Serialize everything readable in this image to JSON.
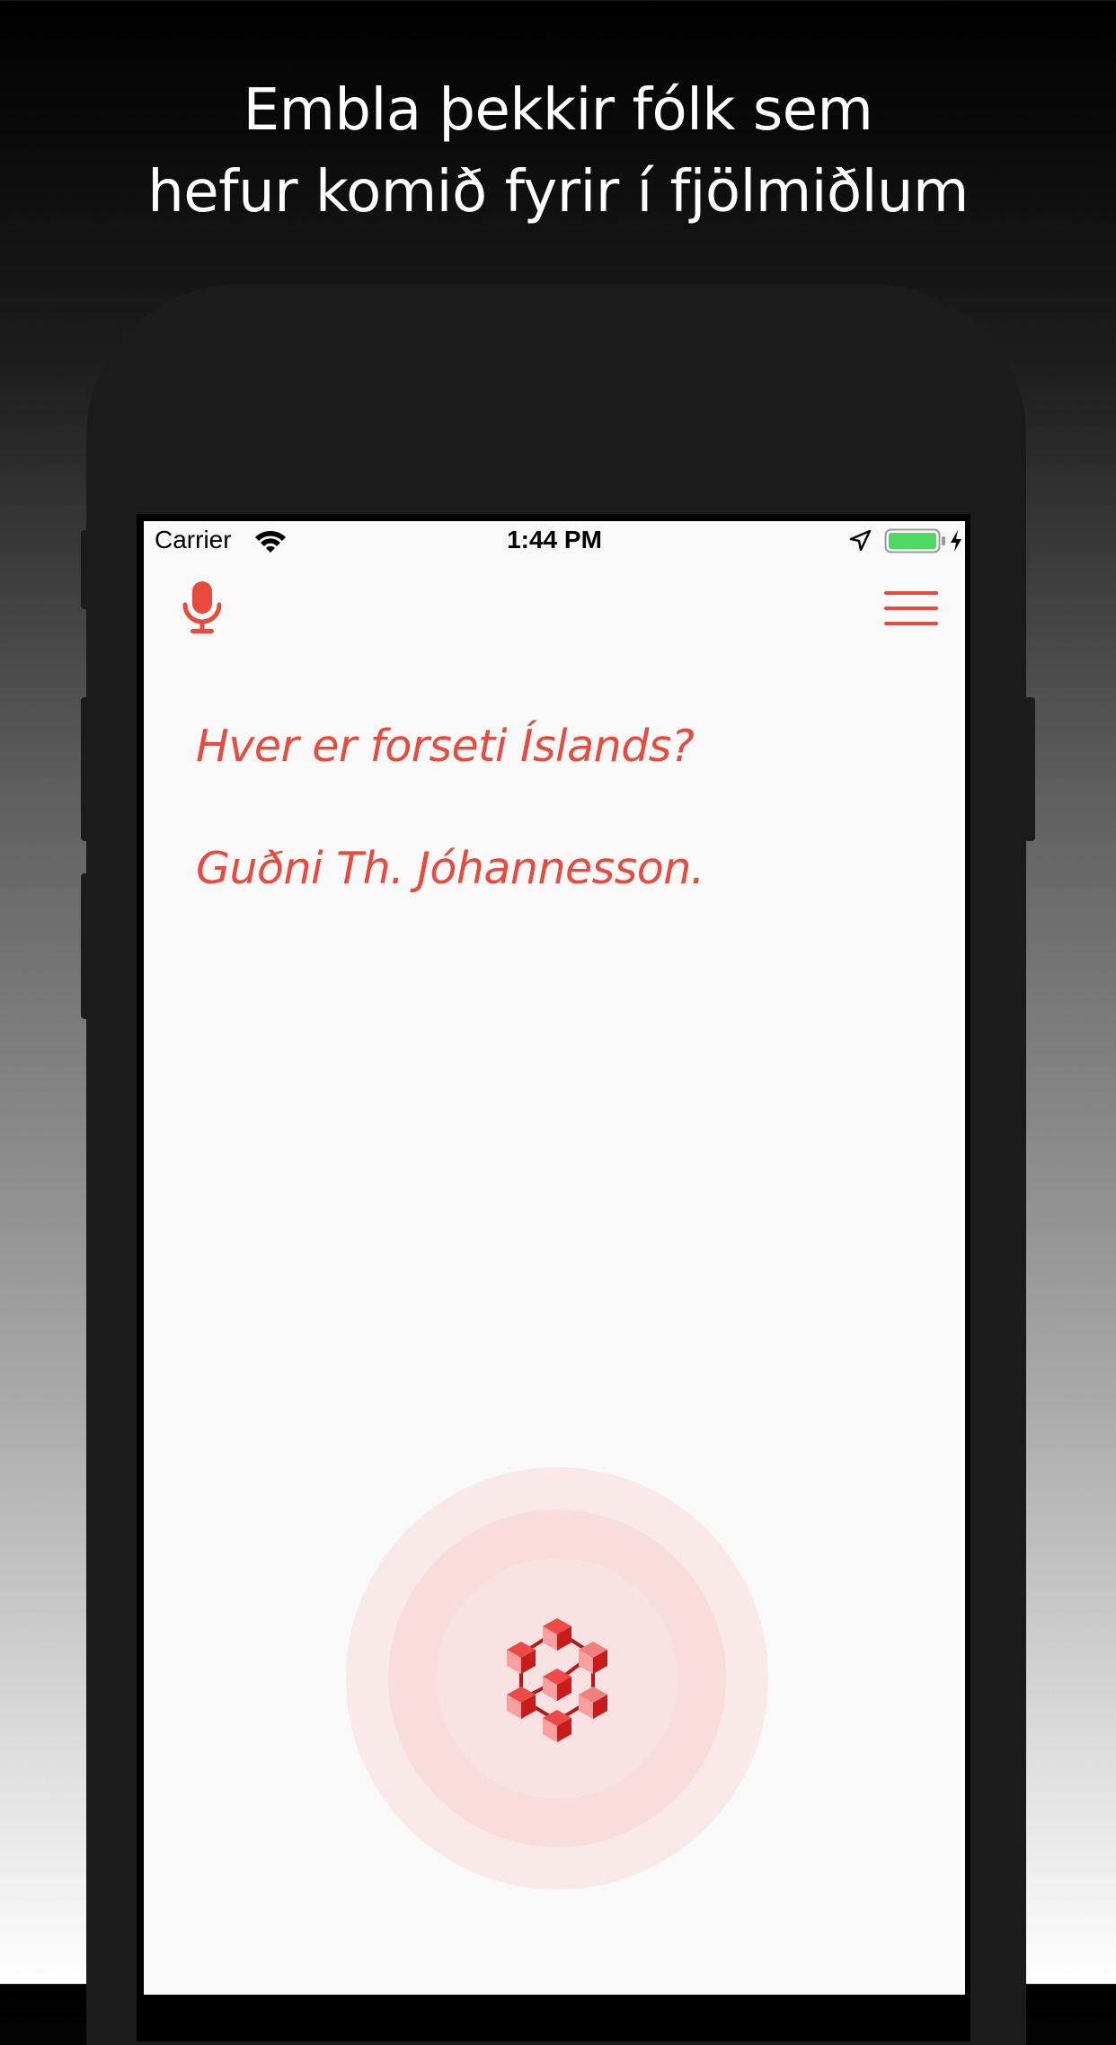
{
  "headline": {
    "line1": "Embla þekkir fólk sem",
    "line2": "hefur komið fyrir í fjölmiðlum"
  },
  "status_bar": {
    "carrier": "Carrier",
    "time": "1:44 PM",
    "icons": [
      "wifi-icon",
      "location-arrow-icon",
      "battery-icon",
      "charging-bolt-icon"
    ]
  },
  "nav": {
    "left_icon": "microphone-icon",
    "right_icon": "hamburger-menu-icon"
  },
  "conversation": {
    "query": "Hver er forseti Íslands?",
    "answer": "Guðni Th. Jóhannesson."
  },
  "listen_button": {
    "icon": "embla-cube-logo-icon"
  },
  "colors": {
    "accent": "#e84a3e",
    "battery_fill": "#4cd964",
    "screen_bg": "#f9f9f9",
    "phone_body": "#1b1b1b"
  }
}
